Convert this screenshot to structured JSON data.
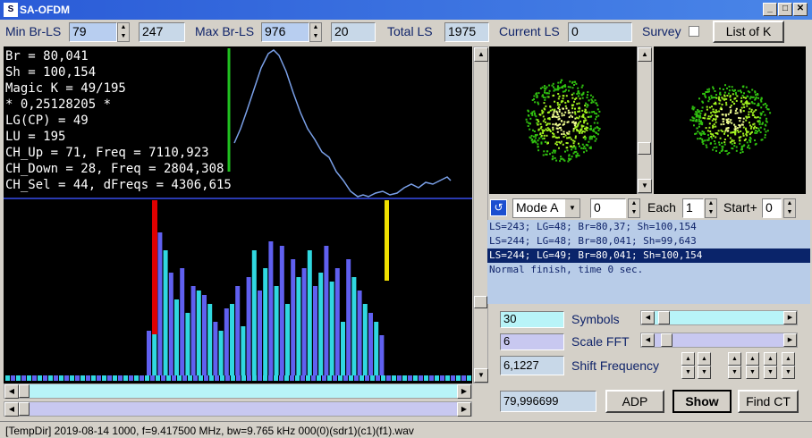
{
  "window": {
    "title": "SA-OFDM",
    "app_icon": "S"
  },
  "top": {
    "min_label": "Min Br-LS",
    "min_value": "79",
    "min_second": "247",
    "max_label": "Max Br-LS",
    "max_value": "976",
    "max_second": "20",
    "total_label": "Total LS",
    "total_value": "1975",
    "current_label": "Current LS",
    "current_value": "0",
    "survey_label": "Survey",
    "list_button": "List of K"
  },
  "info_lines": [
    "Br = 80,041",
    "Sh = 100,154",
    "Magic K = 49/195",
    "* 0,25128205 *",
    "LG(CP) = 49",
    "LU = 195",
    "CH_Up = 71, Freq = 7110,923",
    "CH_Down = 28, Freq = 2804,308",
    "CH_Sel = 44, dFreqs = 4306,615"
  ],
  "mode": {
    "label": "Mode A",
    "value": "0",
    "each_label": "Each",
    "each_value": "1",
    "start_label": "Start+",
    "start_value": "0"
  },
  "log": [
    "LS=243; LG=48; Br=80,37; Sh=100,154",
    "LS=244; LG=48; Br=80,041; Sh=99,643",
    "LS=244; LG=49; Br=80,041; Sh=100,154",
    "Normal finish, time 0 sec."
  ],
  "controls": {
    "symbols_value": "30",
    "symbols_label": "Symbols",
    "scale_value": "6",
    "scale_label": "Scale FFT",
    "shift_value": "6,1227",
    "shift_label": "Shift Frequency",
    "freq_value": "79,996699",
    "adp_button": "ADP",
    "show_button": "Show",
    "findct_button": "Find CT"
  },
  "status_text": "[TempDir] 2019-08-14 1000, f=9.417500 MHz, bw=9.765 kHz 000(0)(sdr1)(c1)(f1).wav",
  "colors": {
    "red_marker": "#e00000",
    "yellow_marker": "#f0e000",
    "cyan": "#30d8e0",
    "violet": "#6060f0",
    "green_marker": "#20c020",
    "curve": "#7aa0e8"
  }
}
